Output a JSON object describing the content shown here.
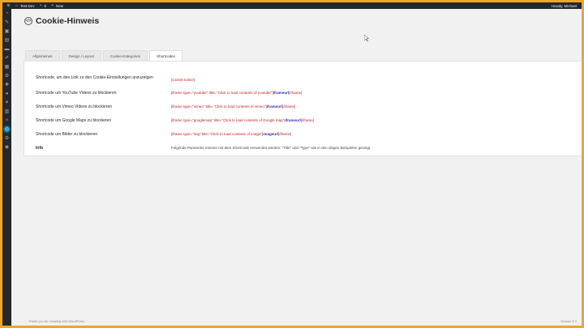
{
  "adminbar": {
    "site": "Test Dev",
    "comments": "0",
    "new_label": "New",
    "greeting": "Howdy, Michael"
  },
  "sidebar": {
    "icons": [
      "wordpress-icon",
      "dashboard-icon",
      "pin-icon",
      "media-icon",
      "pages-icon",
      "comments-icon",
      "appearance-icon",
      "plugins-icon",
      "users-icon",
      "tools-icon",
      "settings-icon",
      "generic-icon",
      "cookie-icon",
      "collapse-icon"
    ]
  },
  "page": {
    "title": "Cookie-Hinweis"
  },
  "tabs": [
    {
      "label": "Allgemeines"
    },
    {
      "label": "Design / Layout"
    },
    {
      "label": "Cookie-Kategorien"
    },
    {
      "label": "Shortcodes"
    }
  ],
  "rows": [
    {
      "label": "Shortcode, um den Link zu den Cookie-Einstellungen anzuzeigen",
      "code_pre": "[cookie-notice]",
      "code_bold": "",
      "code_post": ""
    },
    {
      "label": "Shortcode um YouTube Videos zu blockieren",
      "code_pre": "[iframe type=\"youtube\" title=\"Click to load contents of youtube\"]",
      "code_bold": "iframeurl",
      "code_post": "[/iframe]"
    },
    {
      "label": "Shortcode um Vimeo Videos zu blockieren",
      "code_pre": "[iframe type=\"vimeo\" title=\"Click to load contents of vimeo\"]",
      "code_bold": "iframeurl",
      "code_post": "[/iframe]"
    },
    {
      "label": "Shortcode um Google Maps zu blockieren",
      "code_pre": "[iframe type=\"googlemap\" title=\"Click to load contents of Google map\"]",
      "code_bold": "iframeurl",
      "code_post": "[/iframe]"
    },
    {
      "label": "Shortcode um Bilder zu blockieren",
      "code_pre": "[iframe type=\"img\" title=\"Click to load contents of image\"]",
      "code_bold": "imageurl",
      "code_post": "[/iframe]"
    },
    {
      "label": "Info",
      "code_pre": "Folgende Parameter können mit dem Shortcode verwendet werden: \"Title\" und \"Type\" wie in den obigen Beispielen gezeigt.",
      "code_bold": "",
      "code_post": ""
    }
  ],
  "footer": {
    "thanks": "Thank you for creating with WordPress.",
    "version": "Version 5.3"
  },
  "colors": {
    "border": "#f0a52a",
    "admin_bg": "#23282d",
    "accent": "#0073aa",
    "code_red": "#c31c1c",
    "code_blue": "#2b2bc4"
  }
}
